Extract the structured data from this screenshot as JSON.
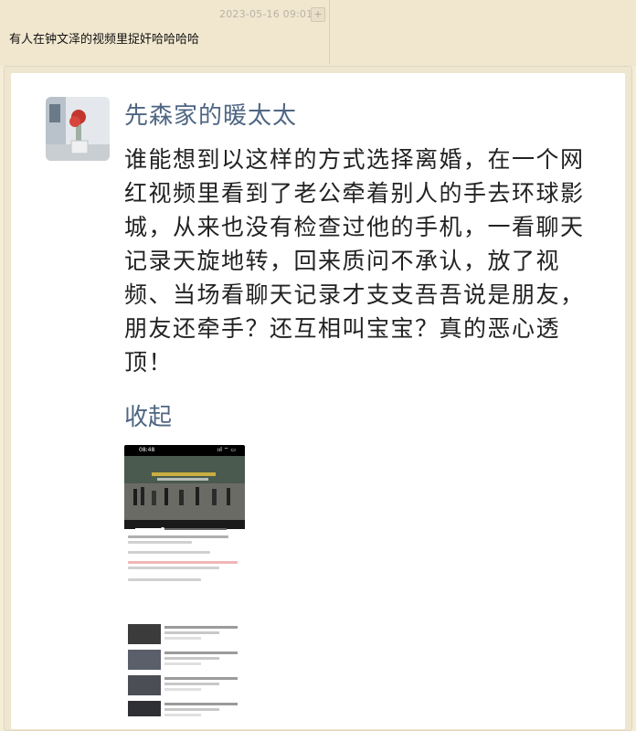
{
  "note": {
    "timestamp": "2023-05-16 09:01",
    "add_label": "+",
    "title": "有人在钟文泽的视频里捉奸哈哈哈哈"
  },
  "post": {
    "username": "先森家的暖太太",
    "body": "谁能想到以这样的方式选择离婚，在一个网红视频里看到了老公牵着别人的手去环球影城，从来也没有检查过他的手机，一看聊天记录天旋地转，回来质问不承认，放了视频、当场看聊天记录才支支吾吾说是朋友，朋友还牵手？还互相叫宝宝？真的恶心透顶！",
    "collapse_label": "收起"
  },
  "screenshot": {
    "status_time": "08:48",
    "status_right": "ııl ⌔ ▭",
    "icon": "phone-screenshot-image"
  },
  "colors": {
    "background": "#f4ecd6",
    "card": "#ffffff",
    "username": "#4f6683",
    "body_text": "#222222",
    "timestamp": "#b9b2a6"
  }
}
